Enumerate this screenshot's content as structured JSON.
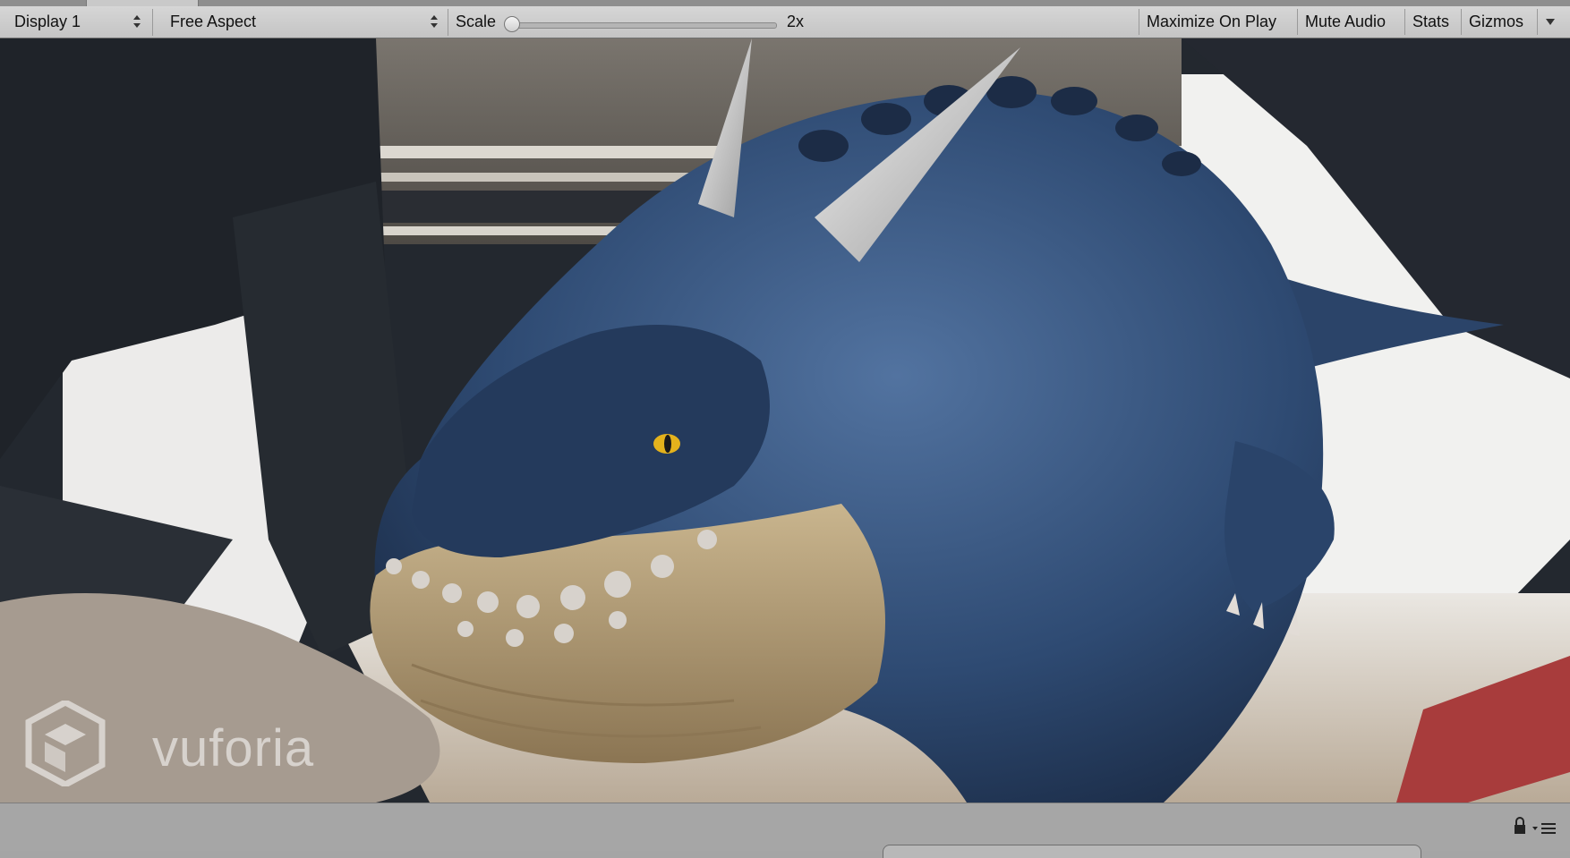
{
  "toolbar": {
    "display_label": "Display 1",
    "aspect_label": "Free Aspect",
    "scale_label": "Scale",
    "scale_value": "2x",
    "scale_fraction": 0.0,
    "maximize_label": "Maximize On Play",
    "mute_label": "Mute Audio",
    "stats_label": "Stats",
    "gizmos_label": "Gizmos"
  },
  "viewport": {
    "watermark_text": "vuforia",
    "subject": "blue-dinosaur-ar-model"
  },
  "bottom": {
    "lock_icon": "lock-icon",
    "menu_icon": "menu-icon"
  },
  "colors": {
    "toolbar_bg": "#cdcdcd",
    "dino_blue": "#2f4a6e",
    "dino_belly": "#b19a72"
  }
}
